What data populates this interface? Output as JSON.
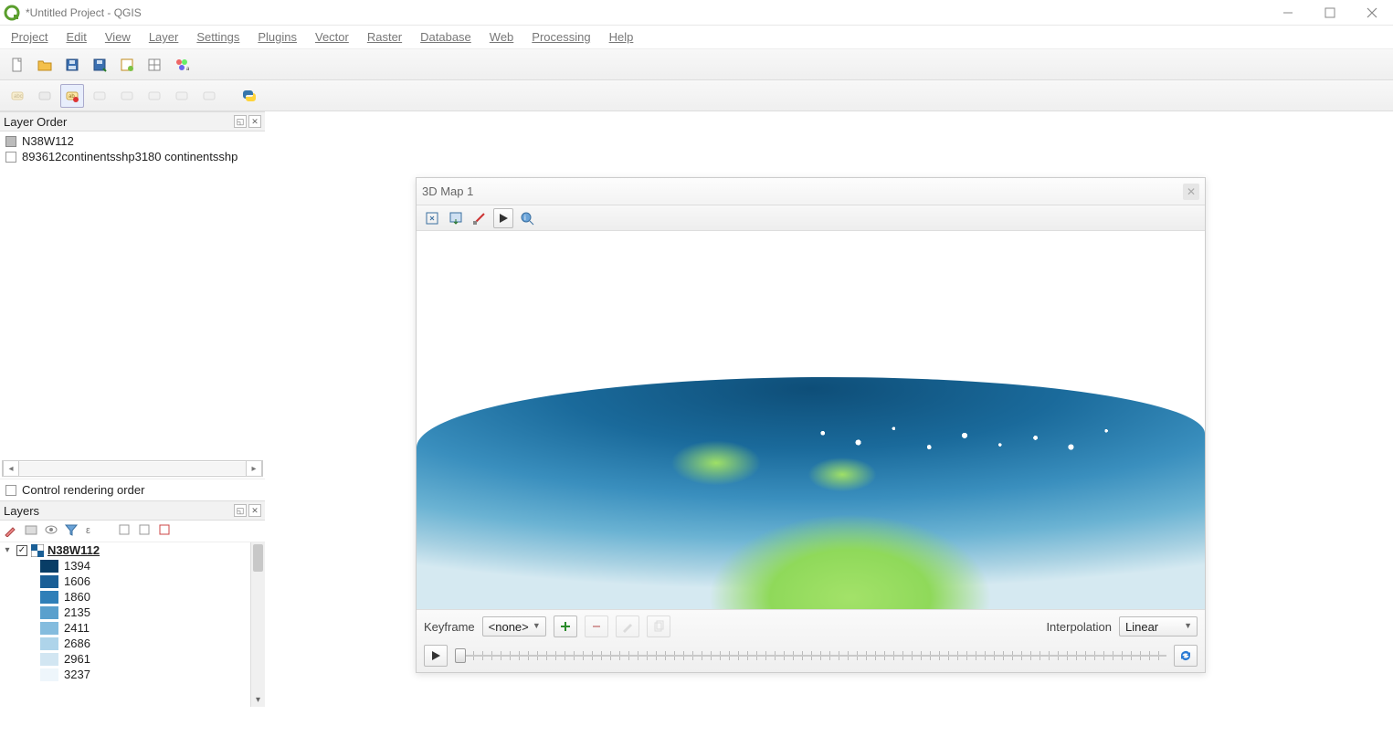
{
  "window": {
    "title": "*Untitled Project - QGIS"
  },
  "menu": [
    "Project",
    "Edit",
    "View",
    "Layer",
    "Settings",
    "Plugins",
    "Vector",
    "Raster",
    "Database",
    "Web",
    "Processing",
    "Help"
  ],
  "panels": {
    "layerOrder": {
      "title": "Layer Order",
      "items": [
        {
          "label": "N38W112",
          "state": "gray"
        },
        {
          "label": "893612continentsshp3180 continentsshp",
          "state": "unchecked"
        }
      ],
      "controlRenderingOrder": "Control rendering order"
    },
    "layers": {
      "title": "Layers",
      "activeLayer": "N38W112",
      "legend": [
        {
          "value": "1394",
          "color": "#083d66"
        },
        {
          "value": "1606",
          "color": "#1a5f96"
        },
        {
          "value": "1860",
          "color": "#2f7fb8"
        },
        {
          "value": "2135",
          "color": "#5aa0cd"
        },
        {
          "value": "2411",
          "color": "#84bcde"
        },
        {
          "value": "2686",
          "color": "#aed4ea"
        },
        {
          "value": "2961",
          "color": "#d2e6f2"
        },
        {
          "value": "3237",
          "color": "#eef6fb"
        }
      ]
    }
  },
  "map3d": {
    "title": "3D Map 1",
    "keyframeLabel": "Keyframe",
    "keyframeValue": "<none>",
    "interpolationLabel": "Interpolation",
    "interpolationValue": "Linear"
  }
}
